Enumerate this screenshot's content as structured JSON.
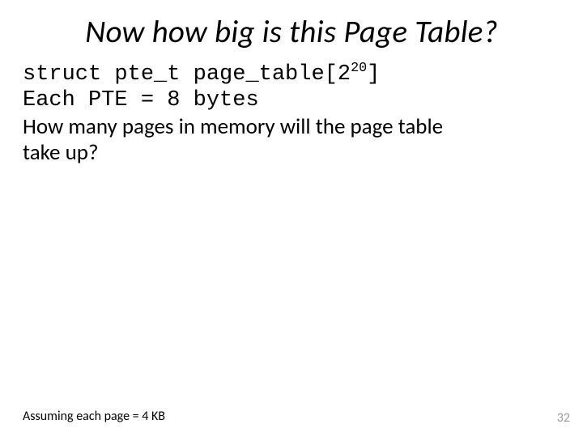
{
  "title": "Now how big is this Page Table?",
  "code": {
    "struct_prefix": "struct pte_t page_table[2",
    "struct_exp": "20",
    "struct_suffix": "]",
    "pte_line": "Each PTE = 8 bytes"
  },
  "question_line1": "How many pages in memory will the page table",
  "question_line2": "take up?",
  "footnote": "Assuming each page = 4 KB",
  "pagenum": "32"
}
